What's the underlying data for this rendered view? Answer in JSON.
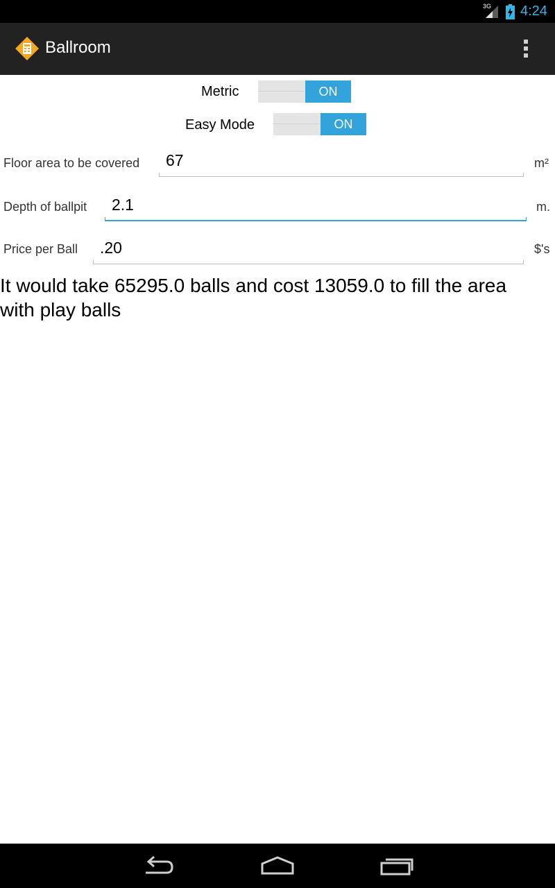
{
  "status_bar": {
    "network_label": "3G",
    "time": "4:24"
  },
  "action_bar": {
    "title": "Ballroom"
  },
  "toggles": {
    "metric": {
      "label": "Metric",
      "state": "ON"
    },
    "easy_mode": {
      "label": "Easy Mode",
      "state": "ON"
    }
  },
  "fields": {
    "floor_area": {
      "label": "Floor area to be covered",
      "value": "67",
      "unit": "m²"
    },
    "depth": {
      "label": "Depth of ballpit",
      "value": "2.1",
      "unit": "m."
    },
    "price": {
      "label": "Price per Ball",
      "value": ".20",
      "unit": "$'s"
    }
  },
  "result": "It would take 65295.0 balls and cost 13059.0 to fill the area with play balls",
  "colors": {
    "accent": "#33a3db",
    "status_time": "#33b5e5",
    "action_bar_bg": "#222222",
    "app_icon": "#f5a623"
  }
}
